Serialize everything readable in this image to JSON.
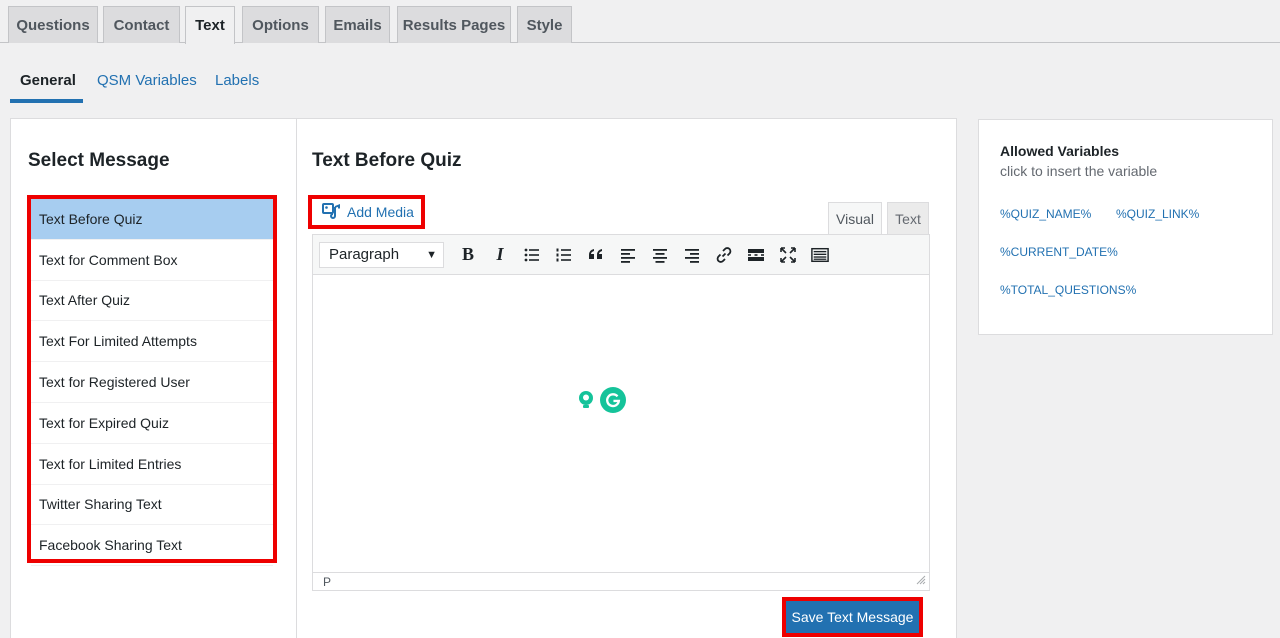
{
  "top_tabs": [
    "Questions",
    "Contact",
    "Text",
    "Options",
    "Emails",
    "Results Pages",
    "Style"
  ],
  "active_top_tab": "Text",
  "sub_tabs": [
    "General",
    "QSM Variables",
    "Labels"
  ],
  "select_message": {
    "title": "Select Message",
    "items": [
      "Text Before Quiz",
      "Text for Comment Box",
      "Text After Quiz",
      "Text For Limited Attempts",
      "Text for Registered User",
      "Text for Expired Quiz",
      "Text for Limited Entries",
      "Twitter Sharing Text",
      "Facebook Sharing Text"
    ],
    "selected": "Text Before Quiz"
  },
  "editor": {
    "title": "Text Before Quiz",
    "add_media_label": "Add Media",
    "mode_visual": "Visual",
    "mode_text": "Text",
    "format_value": "Paragraph",
    "status_path": "P",
    "save_label": "Save Text Message"
  },
  "variables": {
    "title": "Allowed Variables",
    "subtitle": "click to insert the variable",
    "items": [
      "%QUIZ_NAME%",
      "%QUIZ_LINK%",
      "%CURRENT_DATE%",
      "%TOTAL_QUESTIONS%"
    ]
  },
  "colors": {
    "accent": "#2271b1",
    "highlight": "#e00000",
    "selected_item": "#a7cdf0",
    "grammarly": "#15c39a"
  }
}
